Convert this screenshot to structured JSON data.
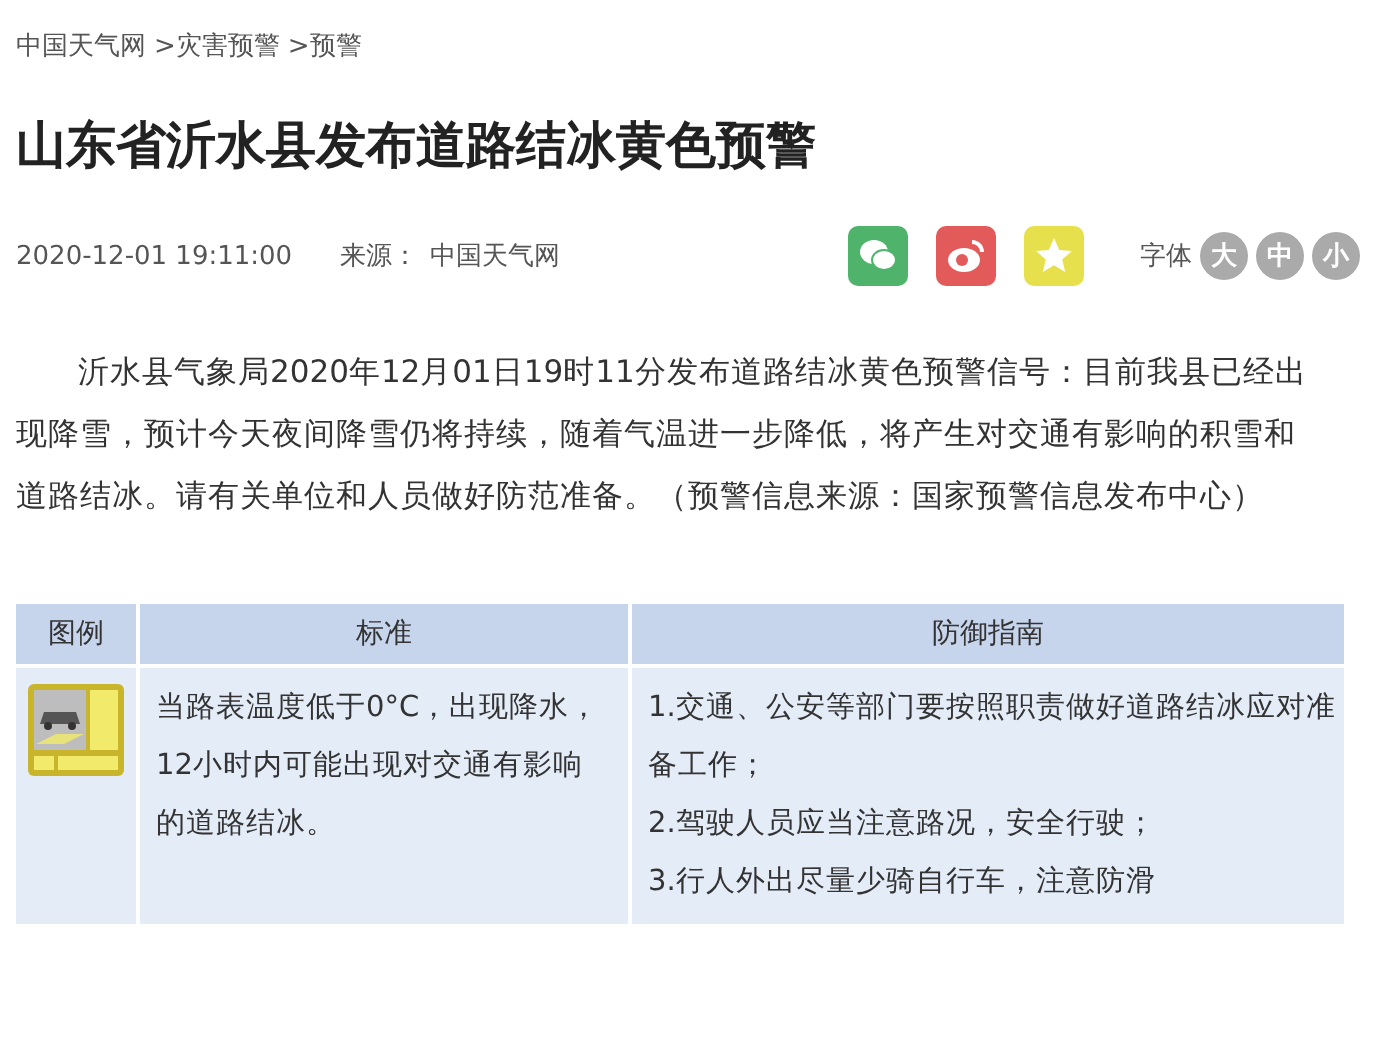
{
  "breadcrumbs": [
    "中国天气网",
    ">灾害预警",
    ">预警"
  ],
  "title": "山东省沂水县发布道路结冰黄色预警",
  "meta": {
    "datetime": "2020-12-01 19:11:00",
    "source_label": "来源：",
    "source": "中国天气网"
  },
  "share_buttons": [
    {
      "kind": "wechat",
      "color": "#4fb36b"
    },
    {
      "kind": "weibo",
      "color": "#e25a5a"
    },
    {
      "kind": "favorite",
      "color": "#e6e04c"
    }
  ],
  "font_size": {
    "label": "字体",
    "options": [
      "大",
      "中",
      "小"
    ]
  },
  "paragraph": "沂水县气象局2020年12月01日19时11分发布道路结冰黄色预警信号：目前我县已经出现降雪，预计今天夜间降雪仍将持续，随着气温进一步降低，将产生对交通有影响的积雪和道路结冰。请有关单位和人员做好防范准备。（预警信息来源：国家预警信息发布中心）",
  "table": {
    "columns": [
      "图例",
      "标准",
      "防御指南"
    ],
    "rows": [
      {
        "standard": "当路表温度低于0°C，出现降水，12小时内可能出现对交通有影响的道路结冰。",
        "guide": [
          "1.交通、公安等部门要按照职责做好道路结冰应对准备工作；",
          "2.驾驶人员应当注意路况，安全行驶；",
          "3.行人外出尽量少骑自行车，注意防滑"
        ]
      }
    ]
  }
}
